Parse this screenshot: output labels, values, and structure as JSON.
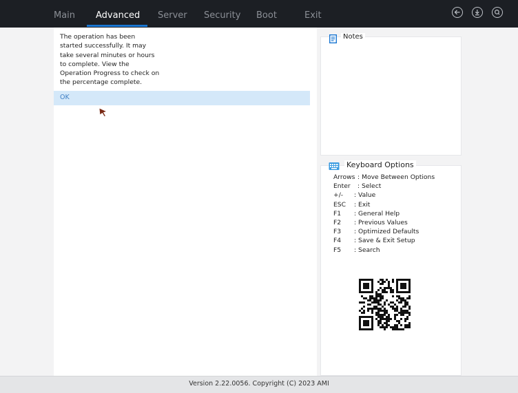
{
  "nav": {
    "tabs": [
      {
        "label": "Main"
      },
      {
        "label": "Advanced"
      },
      {
        "label": "Server"
      },
      {
        "label": "Security"
      },
      {
        "label": "Boot"
      },
      {
        "label": "Exit"
      }
    ],
    "active_tab": "Advanced",
    "icons": [
      "back-icon",
      "download-icon",
      "search-icon"
    ],
    "accent": "#1976d2"
  },
  "dialog": {
    "message_lines": [
      "The operation has been",
      "started successfully. It may",
      "take several minutes or hours",
      "to complete. View the",
      "Operation Progress to check on",
      "the percentage complete."
    ],
    "ok_label": "OK"
  },
  "notes": {
    "title": "Notes"
  },
  "keyboard": {
    "title": "Keyboard Options",
    "items": [
      {
        "key": "Arrows",
        "desc": ": Move Between Options"
      },
      {
        "key": "Enter",
        "desc": ": Select"
      },
      {
        "key": "+/-",
        "desc": ": Value"
      },
      {
        "key": "ESC",
        "desc": ": Exit"
      },
      {
        "key": "F1",
        "desc": ": General Help"
      },
      {
        "key": "F2",
        "desc": ": Previous Values"
      },
      {
        "key": "F3",
        "desc": ": Optimized Defaults"
      },
      {
        "key": "F4",
        "desc": ": Save & Exit Setup"
      },
      {
        "key": "F5",
        "desc": ": Search"
      }
    ]
  },
  "footer": {
    "text": "Version 2.22.0056. Copyright (C) 2023 AMI"
  }
}
